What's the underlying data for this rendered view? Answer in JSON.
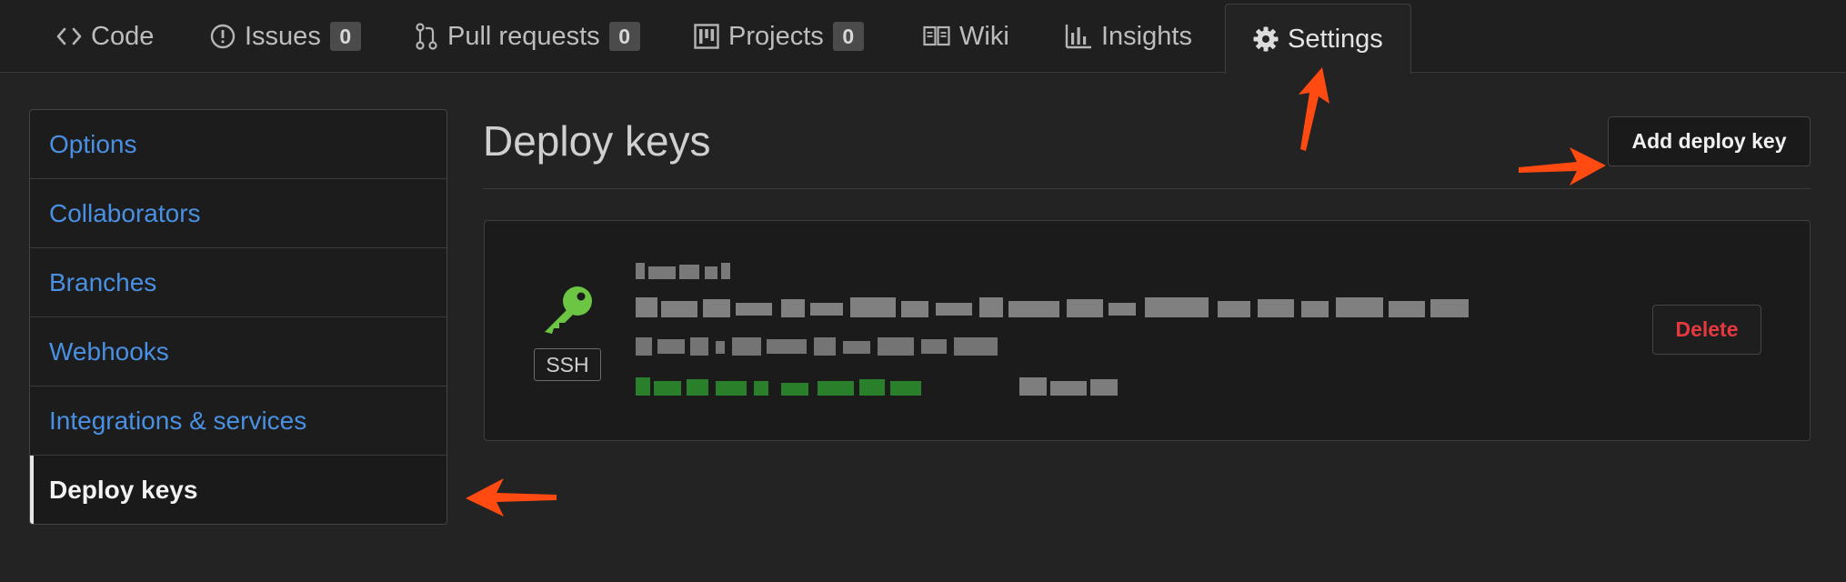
{
  "tabs": [
    {
      "label": "Code",
      "icon": "code-icon"
    },
    {
      "label": "Issues",
      "icon": "issue-icon",
      "count": "0"
    },
    {
      "label": "Pull requests",
      "icon": "pull-request-icon",
      "count": "0"
    },
    {
      "label": "Projects",
      "icon": "project-icon",
      "count": "0"
    },
    {
      "label": "Wiki",
      "icon": "book-icon"
    },
    {
      "label": "Insights",
      "icon": "graph-icon"
    },
    {
      "label": "Settings",
      "icon": "gear-icon",
      "selected": true
    }
  ],
  "sidebar": {
    "items": [
      {
        "label": "Options"
      },
      {
        "label": "Collaborators"
      },
      {
        "label": "Branches"
      },
      {
        "label": "Webhooks"
      },
      {
        "label": "Integrations & services"
      },
      {
        "label": "Deploy keys",
        "active": true
      }
    ]
  },
  "main": {
    "title": "Deploy keys",
    "add_button": "Add deploy key",
    "key": {
      "icon": "key-icon",
      "badge": "SSH",
      "title": "",
      "fingerprint": "",
      "added_line": "",
      "last_used_line": "",
      "delete_button": "Delete"
    }
  },
  "colors": {
    "link": "#4a90e2",
    "key_icon": "#6cc644",
    "delete": "#e5393f",
    "annotation_arrow": "#ff4a12"
  }
}
